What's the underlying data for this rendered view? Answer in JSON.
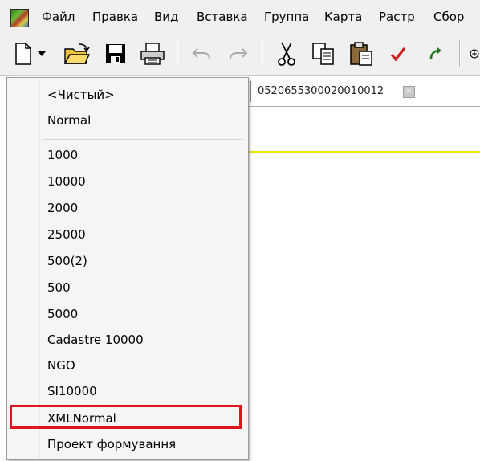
{
  "menubar": {
    "items": [
      "Файл",
      "Правка",
      "Вид",
      "Вставка",
      "Группа",
      "Карта",
      "Растр",
      "Сбор"
    ]
  },
  "toolbar": {
    "icons": [
      "new-document-icon",
      "dropdown-arrow-icon",
      "open-folder-icon",
      "save-icon",
      "print-icon",
      "undo-icon",
      "redo-icon",
      "cut-icon",
      "copy-icon",
      "paste-icon",
      "check-icon",
      "refresh-icon",
      "zoom-icon"
    ]
  },
  "document_tab": {
    "title": "052065530002001001​2"
  },
  "dropdown": {
    "group1": [
      "<Чистый>",
      "Normal"
    ],
    "group2": [
      "1000",
      "10000",
      "2000",
      "25000",
      "500(2)",
      "500",
      "5000",
      "Cadastre 10000",
      "NGO",
      "SI10000",
      "XMLNormal",
      "Проект формування"
    ],
    "highlighted": "XMLNormal"
  },
  "colors": {
    "highlight_border": "#e0141c",
    "guide_line": "#f2e600",
    "check": "#d21a1a"
  }
}
